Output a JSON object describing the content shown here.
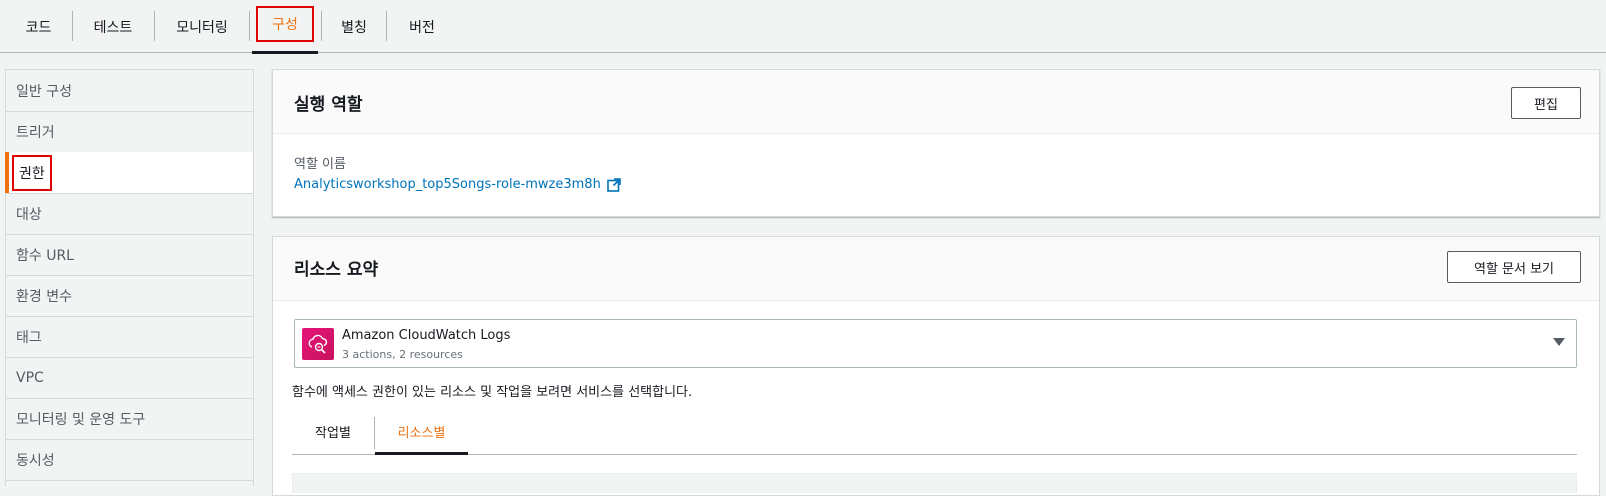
{
  "top_tabs": [
    {
      "label": "코드"
    },
    {
      "label": "테스트"
    },
    {
      "label": "모니터링"
    },
    {
      "label": "구성"
    },
    {
      "label": "별칭"
    },
    {
      "label": "버전"
    }
  ],
  "active_top_tab": "구성",
  "sidebar": {
    "items": [
      {
        "label": "일반 구성"
      },
      {
        "label": "트리거"
      },
      {
        "label": "권한"
      },
      {
        "label": "대상"
      },
      {
        "label": "함수 URL"
      },
      {
        "label": "환경 변수"
      },
      {
        "label": "태그"
      },
      {
        "label": "VPC"
      },
      {
        "label": "모니터링 및 운영 도구"
      },
      {
        "label": "동시성"
      }
    ],
    "active": "권한"
  },
  "execution_role": {
    "title": "실행 역할",
    "edit_label": "편집",
    "role_name_label": "역할 이름",
    "role_name": "Analyticsworkshop_top5Songs-role-mwze3m8h"
  },
  "resource_summary": {
    "title": "리소스 요약",
    "view_doc_label": "역할 문서 보기",
    "service": {
      "name": "Amazon CloudWatch Logs",
      "detail": "3 actions, 2 resources"
    },
    "hint": "함수에 액세스 권한이 있는 리소스 및 작업을 보려면 서비스를 선택합니다.",
    "tabs": [
      {
        "label": "작업별"
      },
      {
        "label": "리소스별"
      }
    ],
    "active_tab": "리소스별"
  },
  "colors": {
    "accent": "#ec7211",
    "link": "#0073bb",
    "highlight_box": "#e00000",
    "service_icon": "#e7157b"
  }
}
